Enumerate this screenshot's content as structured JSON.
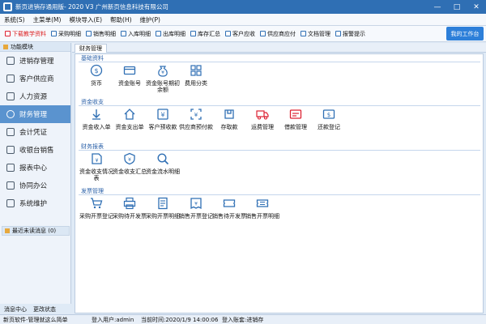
{
  "window": {
    "title": "新页进销存通用版- 2020 V3 广州新页信息科技有限公司"
  },
  "menu": [
    "系统(S)",
    "主菜单(M)",
    "模块导入(E)",
    "帮助(H)",
    "维护(P)"
  ],
  "toolbar": {
    "items": [
      "下载教学资料",
      "采购明细",
      "销售明细",
      "入库明细",
      "出库明细",
      "库存汇总",
      "客户应收",
      "供应商应付",
      "文档管理",
      "报警提示"
    ],
    "workbench": "我的工作台"
  },
  "sidebar": {
    "header": "功能模块",
    "items": [
      "进销存管理",
      "客户供应商",
      "人力资源",
      "财务管理",
      "会计凭证",
      "收银台销售",
      "报表中心",
      "协同办公",
      "系统维护"
    ],
    "active_index": 3,
    "messages": "最近未读消息 (0)",
    "bottom": [
      "消息中心",
      "更改状态"
    ]
  },
  "tabs": [
    "财务管理"
  ],
  "sections": [
    {
      "title": "基础资料",
      "items": [
        {
          "label": "货币",
          "icon": "coin-icon"
        },
        {
          "label": "资金账号",
          "icon": "card-icon"
        },
        {
          "label": "资金账号期初余额",
          "icon": "moneybag-icon"
        },
        {
          "label": "费用分类",
          "icon": "grid-icon"
        }
      ]
    },
    {
      "title": "资金收支",
      "items": [
        {
          "label": "资金收入单",
          "icon": "income-icon"
        },
        {
          "label": "资金支出单",
          "icon": "expense-icon"
        },
        {
          "label": "客户预收款",
          "icon": "customer-prepay-icon"
        },
        {
          "label": "供应商预付款",
          "icon": "supplier-prepay-icon"
        },
        {
          "label": "存取款",
          "icon": "deposit-icon"
        },
        {
          "label": "运费管理",
          "icon": "truck-icon"
        },
        {
          "label": "借款管理",
          "icon": "loan-icon"
        },
        {
          "label": "还款登记",
          "icon": "repay-icon"
        }
      ]
    },
    {
      "title": "财务报表",
      "items": [
        {
          "label": "资金收支情况表",
          "icon": "report-icon"
        },
        {
          "label": "资金收支汇总",
          "icon": "summary-icon"
        },
        {
          "label": "资金流水明细",
          "icon": "flow-search-icon"
        }
      ]
    },
    {
      "title": "发票管理",
      "items": [
        {
          "label": "采购开票登记",
          "icon": "cart-invoice-icon"
        },
        {
          "label": "采购待开发票",
          "icon": "printer-icon"
        },
        {
          "label": "采购开票明细",
          "icon": "invoice-detail-icon"
        },
        {
          "label": "销售开票登记",
          "icon": "sale-invoice-icon"
        },
        {
          "label": "销售待开发票",
          "icon": "ticket-icon"
        },
        {
          "label": "销售开票明细",
          "icon": "ticket-detail-icon"
        }
      ]
    }
  ],
  "status": {
    "left": "新页软件-管理就这么简单",
    "user": "登入用户:admin",
    "time": "当前时间:2020/1/9 14:00:06",
    "account": "登入账套:进销存"
  },
  "colors": {
    "title_bar": "#2f6fb4",
    "accent": "#2d7fd9",
    "active_sidebar": "#5a93cf",
    "icon": "#2f6fb4"
  }
}
